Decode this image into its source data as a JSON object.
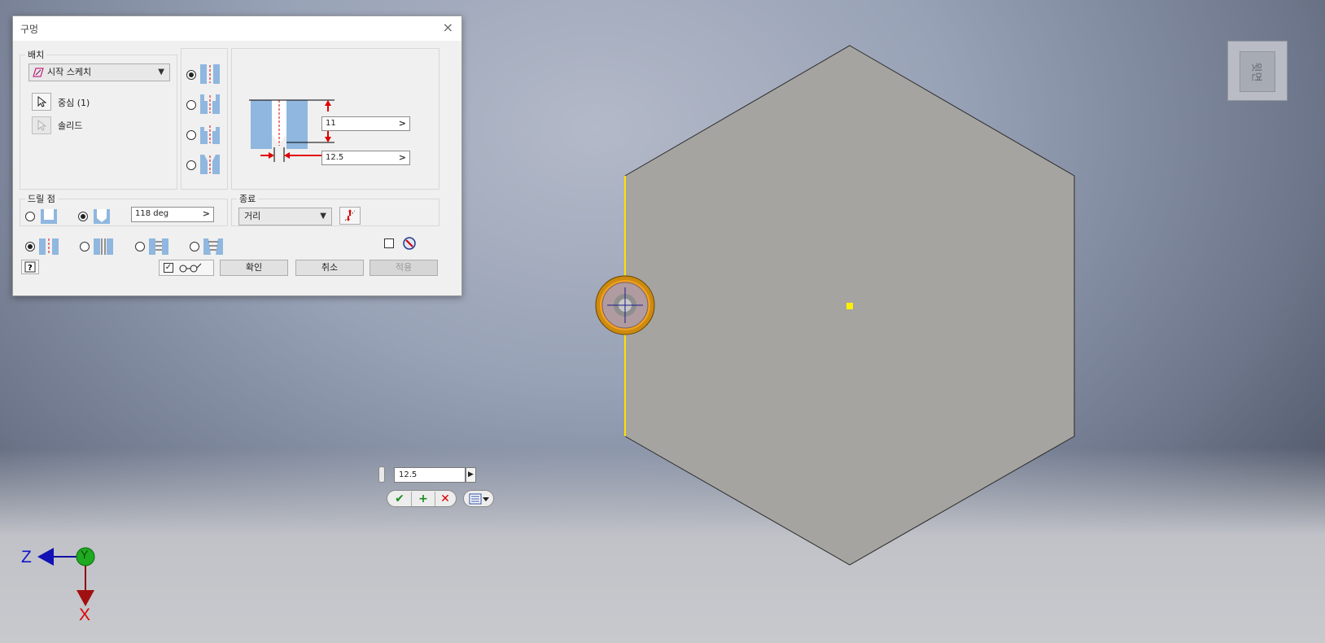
{
  "dialog": {
    "title": "구멍",
    "close_label": "×",
    "placement": {
      "legend": "배치",
      "type_select": "시작 스케치",
      "center_label": "중심 (1)",
      "solid_label": "솔리드"
    },
    "dimensions": {
      "depth_value": "11",
      "diameter_value": "12.5"
    },
    "drill_point": {
      "legend": "드릴 점",
      "angle_value": "118 deg",
      "selected": "angled"
    },
    "termination": {
      "legend": "종료",
      "value": "거리"
    },
    "buttons": {
      "ok": "확인",
      "cancel": "취소",
      "apply": "적용"
    }
  },
  "mini_toolbar": {
    "value": "12.5"
  },
  "viewcube": {
    "face_label": "윗면"
  },
  "triad": {
    "z_label": "Z",
    "y_label": "Y",
    "x_label": "X"
  },
  "colors": {
    "accent_red": "#e00000",
    "part_face": "#a5a4a0",
    "highlight_yellow": "#ffe000"
  }
}
